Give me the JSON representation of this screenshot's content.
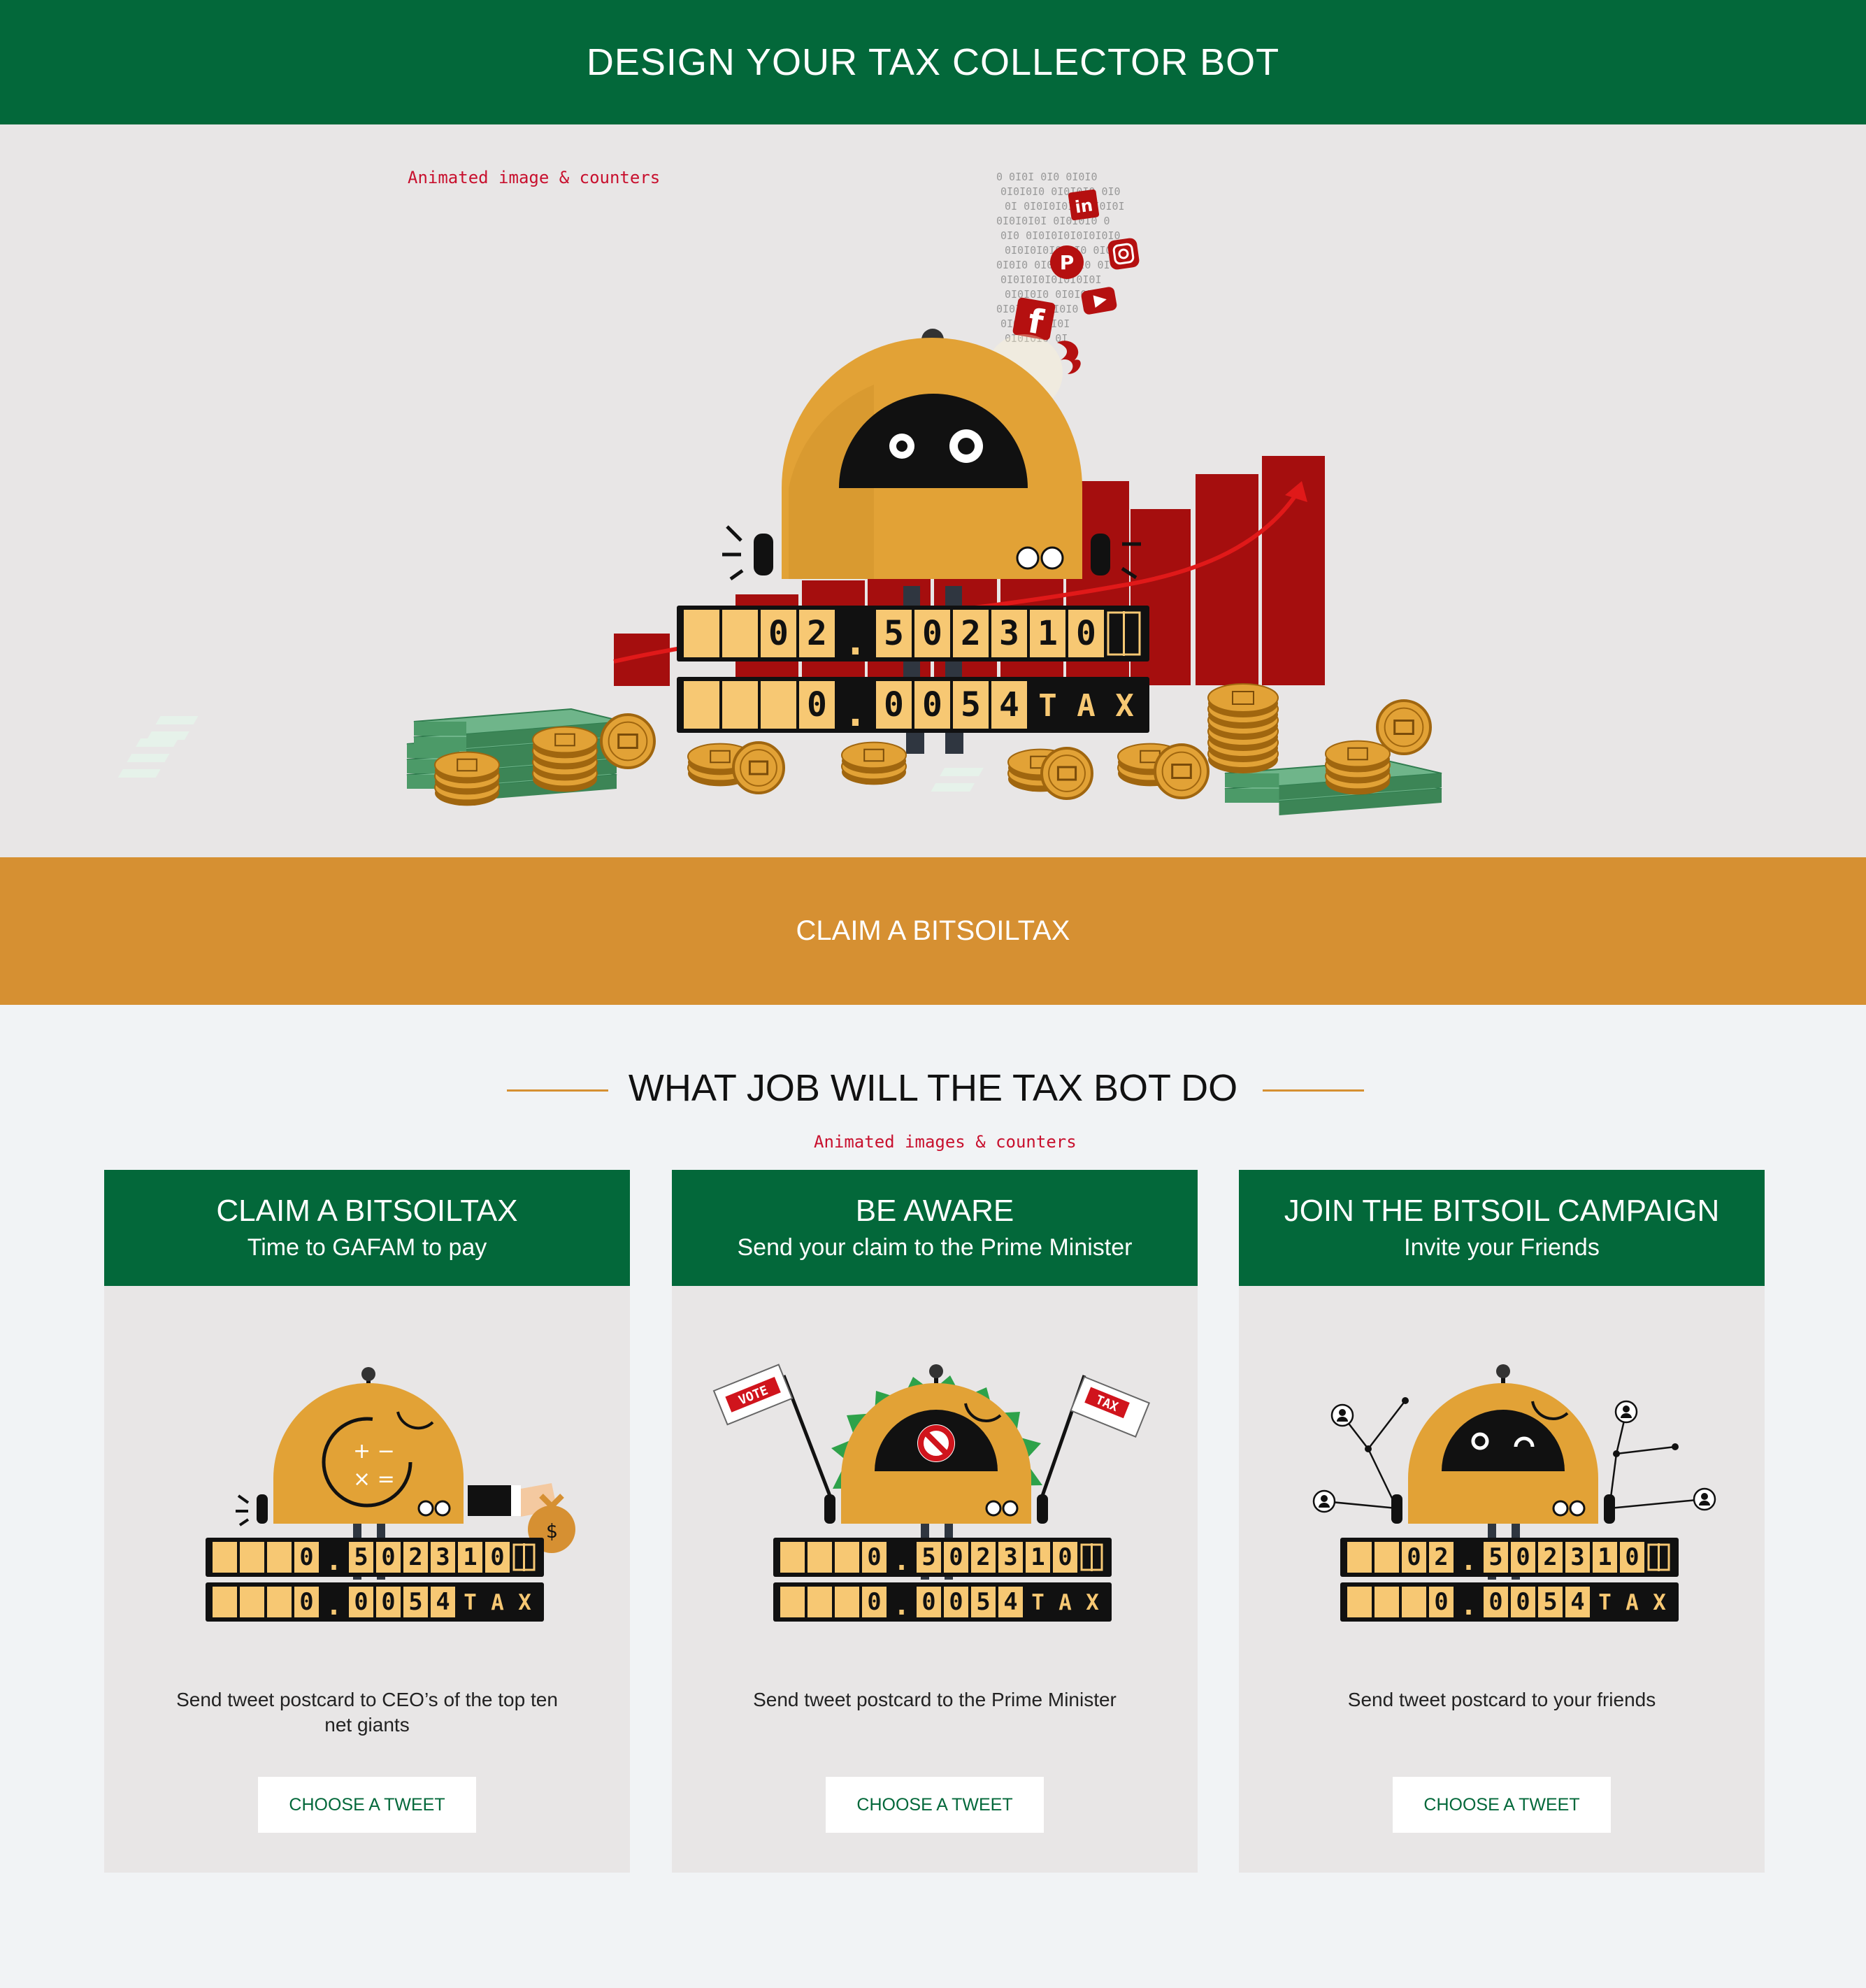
{
  "header": {
    "title": "DESIGN YOUR TAX COLLECTOR BOT"
  },
  "hero": {
    "note": "Animated image & counters",
    "counter_top": {
      "digits": [
        "",
        "",
        "0",
        "2",
        ".",
        "5",
        "0",
        "2",
        "3",
        "1",
        "0"
      ]
    },
    "counter_bottom": {
      "digits": [
        "",
        "",
        "",
        "0",
        ".",
        "0",
        "0",
        "5",
        "4"
      ],
      "suffix": [
        "T",
        "A",
        "X"
      ]
    }
  },
  "claim_bar": {
    "label": "CLAIM A BITSOILTAX"
  },
  "jobs": {
    "title": "WHAT JOB WILL THE TAX BOT DO",
    "note": "Animated images & counters",
    "cards": [
      {
        "title": "CLAIM A BITSOILTAX",
        "subtitle": "Time to GAFAM to pay",
        "text": "Send tweet postcard to CEO’s of the top ten net giants",
        "button": "CHOOSE A TWEET",
        "counter_top": [
          "",
          "",
          "",
          "0",
          ".",
          "5",
          "0",
          "2",
          "3",
          "1",
          "0"
        ],
        "counter_bottom": [
          "",
          "",
          "",
          "0",
          ".",
          "0",
          "0",
          "5",
          "4"
        ],
        "suffix": [
          "T",
          "A",
          "X"
        ]
      },
      {
        "title": "BE AWARE",
        "subtitle": "Send your claim to the Prime Minister",
        "text": "Send tweet postcard to the Prime Minister",
        "button": "CHOOSE A TWEET",
        "flag_left": "VOTE",
        "flag_right": "TAX",
        "counter_top": [
          "",
          "",
          "",
          "0",
          ".",
          "5",
          "0",
          "2",
          "3",
          "1",
          "0"
        ],
        "counter_bottom": [
          "",
          "",
          "",
          "0",
          ".",
          "0",
          "0",
          "5",
          "4"
        ],
        "suffix": [
          "T",
          "A",
          "X"
        ]
      },
      {
        "title": "JOIN THE BITSOIL CAMPAIGN",
        "subtitle": "Invite your Friends",
        "text": "Send tweet postcard to your friends",
        "button": "CHOOSE A TWEET",
        "counter_top": [
          "",
          "",
          "0",
          "2",
          ".",
          "5",
          "0",
          "2",
          "3",
          "1",
          "0"
        ],
        "counter_bottom": [
          "",
          "",
          "",
          "0",
          ".",
          "0",
          "0",
          "5",
          "4"
        ],
        "suffix": [
          "T",
          "A",
          "X"
        ]
      }
    ]
  },
  "colors": {
    "green": "#03683a",
    "gold": "#d69032",
    "robot": "#e2a236",
    "red": "#a50e0e",
    "bright_red": "#e01919",
    "black": "#111111"
  },
  "icons": [
    "linkedin-icon",
    "pinterest-icon",
    "instagram-icon",
    "facebook-icon",
    "youtube-icon",
    "google-icon",
    "bitsoil-coin-icon",
    "money-stack-icon"
  ]
}
